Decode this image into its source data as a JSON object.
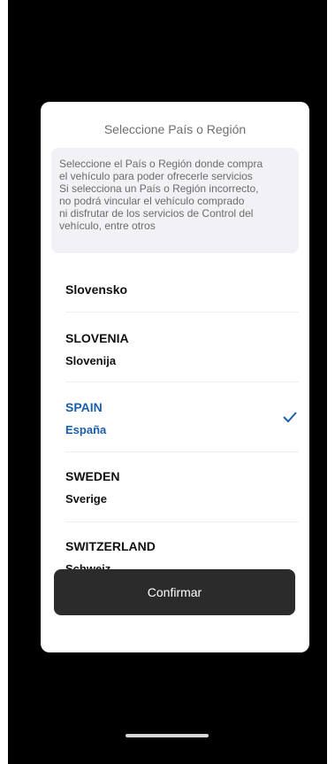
{
  "dialog": {
    "title": "Seleccione País o Región",
    "notice_lines": [
      "Seleccione el País o Región donde compra",
      "el vehículo para poder ofrecerle servicios",
      "Si selecciona un País o Región incorrecto,",
      "no podrá vincular el vehículo comprado",
      "ni disfrutar de los servicios de Control del",
      "vehículo, entre otros"
    ],
    "countries": [
      {
        "name": "Slovensko",
        "selected": false
      },
      {
        "name": "SLOVENIA",
        "native": "Slovenija",
        "selected": false
      },
      {
        "name": "SPAIN",
        "native": "España",
        "selected": true
      },
      {
        "name": "SWEDEN",
        "native": "Sverige",
        "selected": false
      },
      {
        "name": "SWITZERLAND",
        "native": "Schweiz",
        "selected": false
      }
    ],
    "selected_icon": "checkmark-icon",
    "confirm_label": "Confirmar"
  },
  "colors": {
    "selected_accent": "#1a5fa8",
    "button_background": "#2b2b2b",
    "notice_background": "#f2f2f6"
  }
}
